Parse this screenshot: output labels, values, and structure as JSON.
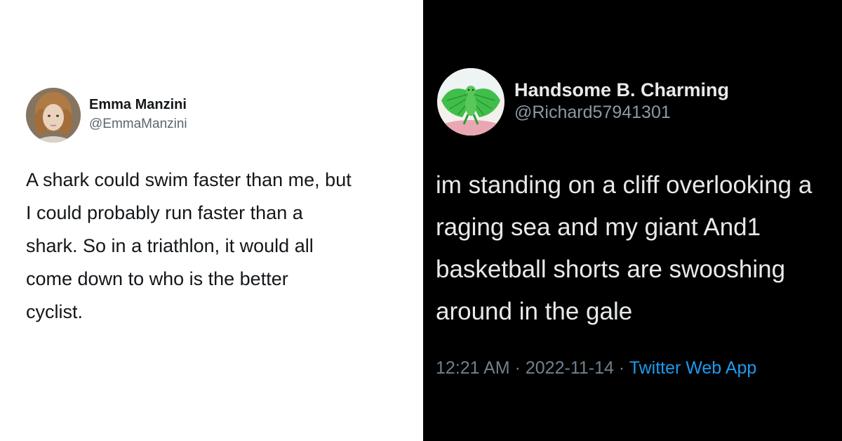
{
  "left_tweet": {
    "author_name": "Emma Manzini",
    "handle": "@EmmaManzini",
    "text_lines": [
      "A shark could swim faster than me, but",
      "I could probably run faster than a",
      "shark. So in a triathlon, it would all",
      "come down to who is the better",
      "cyclist."
    ],
    "colors": {
      "background": "#ffffff",
      "text": "#14171a",
      "handle": "#5b6670"
    }
  },
  "right_tweet": {
    "author_name": "Handsome B. Charming",
    "handle": "@Richard57941301",
    "text_lines": [
      "im standing on a cliff overlooking a",
      "raging sea and my giant And1",
      "basketball shorts are swooshing",
      "around in the gale"
    ],
    "time": "12:21 AM",
    "separator": "·",
    "date": "2022-11-14",
    "source": "Twitter Web App",
    "colors": {
      "background": "#000000",
      "text": "#e7e9ea",
      "meta": "#71808c",
      "link": "#1d9bf0"
    }
  }
}
